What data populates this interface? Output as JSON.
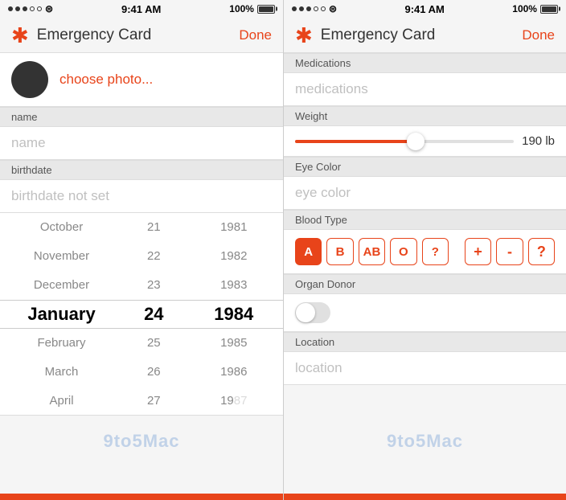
{
  "left_panel": {
    "status_bar": {
      "time": "9:41 AM",
      "battery": "100%"
    },
    "header": {
      "title": "Emergency Card",
      "done_label": "Done"
    },
    "photo": {
      "choose_label": "choose photo..."
    },
    "name_section": {
      "label": "name",
      "placeholder": "name"
    },
    "birthdate_section": {
      "label": "birthdate",
      "not_set": "birthdate not set"
    },
    "date_picker": {
      "months": [
        "October",
        "November",
        "December",
        "January",
        "February",
        "March",
        "April"
      ],
      "days": [
        "21",
        "22",
        "23",
        "24",
        "25",
        "26",
        "27"
      ],
      "years": [
        "1981",
        "1982",
        "1983",
        "1984",
        "1985",
        "1986",
        "1987"
      ],
      "selected_month": "January",
      "selected_day": "24",
      "selected_year": "1984"
    }
  },
  "right_panel": {
    "status_bar": {
      "time": "9:41 AM",
      "battery": "100%"
    },
    "header": {
      "title": "Emergency Card",
      "done_label": "Done"
    },
    "medications": {
      "label": "Medications",
      "placeholder": "medications"
    },
    "weight": {
      "label": "Weight",
      "value": "190",
      "unit": "lb"
    },
    "eye_color": {
      "label": "Eye Color",
      "placeholder": "eye color"
    },
    "blood_type": {
      "label": "Blood Type",
      "types": [
        "A",
        "B",
        "AB",
        "O",
        "?"
      ],
      "rh": [
        "+",
        "-",
        "?"
      ],
      "selected": "A"
    },
    "organ_donor": {
      "label": "Organ Donor"
    },
    "location": {
      "label": "Location",
      "placeholder": "location"
    }
  },
  "watermark": "9to5Mac"
}
